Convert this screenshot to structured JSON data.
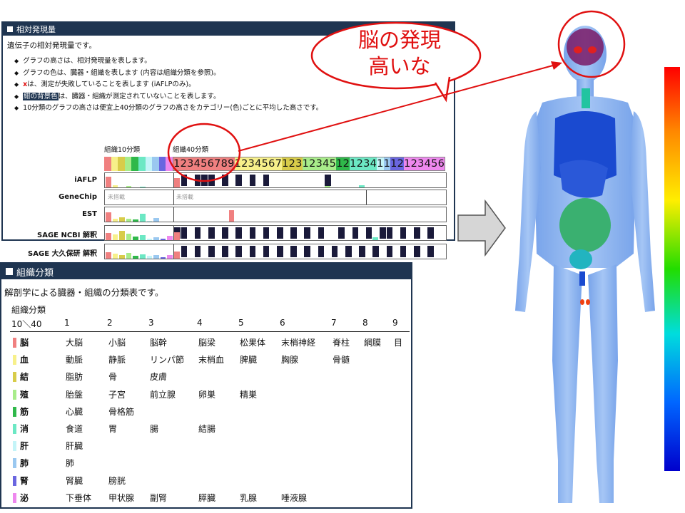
{
  "panel1": {
    "title": "相対発現量",
    "description": "遺伝子の相対発現量です。",
    "notes": [
      {
        "pre": "",
        "em": "",
        "post": "グラフの高さは、相対発現量を表します。"
      },
      {
        "pre": "",
        "em": "",
        "post": "グラフの色は、臓器・組織を表します (内容は組織分類を参照)。"
      },
      {
        "pre": "",
        "em": "x",
        "post": "は、測定が失敗していることを表します (iAFLPのみ)。"
      },
      {
        "pre": "",
        "em": "紺の背景色",
        "post": "は、臓器・組織が測定されていないことを表します。"
      },
      {
        "pre": "",
        "em": "",
        "post": "10分類のグラフの高さは便宜上40分類のグラフの高さをカテゴリー(色)ごとに平均した高さです。"
      }
    ],
    "label_10": "組織10分類",
    "label_40": "組織40分類",
    "digits": [
      "1",
      "2",
      "3",
      "4",
      "5",
      "6",
      "7",
      "8",
      "9",
      "1",
      "2",
      "3",
      "4",
      "5",
      "6",
      "7",
      "1",
      "2",
      "3",
      "1",
      "2",
      "3",
      "4",
      "5",
      "1",
      "2",
      "1",
      "2",
      "3",
      "4",
      "1",
      "1",
      "1",
      "2",
      "1",
      "2",
      "3",
      "4",
      "5",
      "6"
    ],
    "digit_colors": [
      "#f08080",
      "#f08080",
      "#f08080",
      "#f08080",
      "#f08080",
      "#f08080",
      "#f08080",
      "#f08080",
      "#f08080",
      "#f7f08a",
      "#f7f08a",
      "#f7f08a",
      "#f7f08a",
      "#f7f08a",
      "#f7f08a",
      "#f7f08a",
      "#d8cc4a",
      "#d8cc4a",
      "#d8cc4a",
      "#a8ec8a",
      "#a8ec8a",
      "#a8ec8a",
      "#a8ec8a",
      "#a8ec8a",
      "#2fb84a",
      "#2fb84a",
      "#6ce8c4",
      "#6ce8c4",
      "#6ce8c4",
      "#6ce8c4",
      "#c4f4f8",
      "#9ac8f0",
      "#6a66e0",
      "#6a66e0",
      "#ee88ee",
      "#ee88ee",
      "#ee88ee",
      "#ee88ee",
      "#ee88ee",
      "#ee88ee"
    ],
    "cats10_colors": [
      "#f08080",
      "#f7f08a",
      "#d8cc4a",
      "#a8ec8a",
      "#2fb84a",
      "#6ce8c4",
      "#c4f4f8",
      "#9ac8f0",
      "#6a66e0",
      "#ee88ee"
    ],
    "na_text": "未搭載",
    "rows": [
      {
        "label": "iAFLP",
        "bars10": [
          0.85,
          0.15,
          0,
          0.1,
          0,
          0.05,
          0,
          0,
          0,
          0
        ],
        "bars40": [
          0.75,
          0,
          0,
          0,
          0,
          0,
          0,
          0,
          0,
          0,
          0,
          0,
          0,
          0,
          0,
          0,
          0,
          0,
          0,
          0,
          0,
          0,
          0.12,
          0,
          0,
          0,
          0,
          0.18,
          0,
          0,
          0,
          0,
          0,
          0,
          0,
          0,
          0,
          0,
          0,
          0
        ],
        "blocks": [
          1,
          3,
          4,
          5,
          7,
          9,
          11,
          13,
          22
        ],
        "na": false
      },
      {
        "label": "GeneChip",
        "bars10": [],
        "bars40": [],
        "blocks": [],
        "na": true
      },
      {
        "label": "EST",
        "bars10": [
          0.7,
          0.2,
          0.35,
          0.2,
          0.15,
          0.6,
          0.05,
          0.3,
          0,
          0
        ],
        "bars40": [
          0,
          0,
          0,
          0,
          0,
          0,
          0,
          0,
          0.9,
          0,
          0,
          0,
          0,
          0,
          0,
          0,
          0,
          0,
          0,
          0,
          0,
          0,
          0,
          0,
          0,
          0,
          0,
          0,
          0,
          0,
          0,
          0,
          0,
          0,
          0,
          0,
          0,
          0,
          0,
          0
        ],
        "blocks": [],
        "na": false
      },
      {
        "label": "SAGE NCBI 解釈",
        "bars10": [
          0.55,
          0.45,
          0.7,
          0.5,
          0.3,
          0.4,
          0.1,
          0.25,
          0.1,
          0.35
        ],
        "bars40": [
          0.6,
          0,
          0,
          0,
          0,
          0,
          0,
          0,
          0,
          0,
          0,
          0,
          0,
          0,
          0,
          0,
          0,
          0,
          0,
          0,
          0,
          0,
          0,
          0,
          0,
          0,
          0,
          0,
          0,
          0.2,
          0,
          0,
          0,
          0,
          0,
          0,
          0,
          0,
          0,
          0
        ],
        "blocks": [
          0,
          1,
          3,
          5,
          7,
          9,
          11,
          13,
          15,
          17,
          19,
          21,
          24,
          26,
          28,
          30,
          31,
          33,
          35,
          37
        ],
        "na": false
      },
      {
        "label": "SAGE 大久保研 解釈",
        "bars10": [
          0.5,
          0.4,
          0.3,
          0.45,
          0.25,
          0.35,
          0.2,
          0.3,
          0.1,
          0.3
        ],
        "bars40": [
          0.55,
          0,
          0,
          0,
          0,
          0,
          0,
          0,
          0,
          0,
          0,
          0,
          0,
          0,
          0,
          0,
          0,
          0,
          0,
          0,
          0,
          0,
          0,
          0,
          0,
          0,
          0,
          0,
          0,
          0,
          0,
          0,
          0,
          0,
          0,
          0,
          0,
          0,
          0,
          0
        ],
        "blocks": [
          1,
          3,
          5,
          7,
          9,
          11,
          13,
          15,
          17,
          19,
          21,
          23,
          25,
          27,
          29,
          31,
          33,
          35,
          37
        ],
        "na": false
      }
    ]
  },
  "panel2": {
    "title": "組織分類",
    "description": "解剖学による臓器・組織の分類表です。",
    "header_main": "組織分類",
    "header_sub": "10＼40",
    "col_nums": [
      "1",
      "2",
      "3",
      "4",
      "5",
      "6",
      "7",
      "8",
      "9"
    ],
    "rows": [
      {
        "cat": "脳",
        "color": "#f08080",
        "items": [
          "大脳",
          "小脳",
          "脳幹",
          "脳梁",
          "松果体",
          "末梢神経",
          "脊柱",
          "網膜",
          "目"
        ]
      },
      {
        "cat": "血",
        "color": "#f7f08a",
        "items": [
          "動脈",
          "静脈",
          "リンパ節",
          "末梢血",
          "脾臓",
          "胸腺",
          "骨髄",
          "",
          ""
        ]
      },
      {
        "cat": "結",
        "color": "#d8cc4a",
        "items": [
          "脂肪",
          "骨",
          "皮膚",
          "",
          "",
          "",
          "",
          "",
          ""
        ]
      },
      {
        "cat": "殖",
        "color": "#a8ec8a",
        "items": [
          "胎盤",
          "子宮",
          "前立腺",
          "卵巣",
          "精巣",
          "",
          "",
          "",
          ""
        ]
      },
      {
        "cat": "筋",
        "color": "#2fb84a",
        "items": [
          "心臓",
          "骨格筋",
          "",
          "",
          "",
          "",
          "",
          "",
          ""
        ]
      },
      {
        "cat": "消",
        "color": "#6ce8c4",
        "items": [
          "食道",
          "胃",
          "腸",
          "結腸",
          "",
          "",
          "",
          "",
          ""
        ]
      },
      {
        "cat": "肝",
        "color": "#c4f4f8",
        "items": [
          "肝臓",
          "",
          "",
          "",
          "",
          "",
          "",
          "",
          ""
        ]
      },
      {
        "cat": "肺",
        "color": "#9ac8f0",
        "items": [
          "肺",
          "",
          "",
          "",
          "",
          "",
          "",
          "",
          ""
        ]
      },
      {
        "cat": "腎",
        "color": "#6a66e0",
        "items": [
          "腎臓",
          "膀胱",
          "",
          "",
          "",
          "",
          "",
          "",
          ""
        ]
      },
      {
        "cat": "泌",
        "color": "#ee88ee",
        "items": [
          "下垂体",
          "甲状腺",
          "副腎",
          "膵臓",
          "乳腺",
          "唾液腺",
          "",
          "",
          ""
        ]
      }
    ]
  },
  "callout": {
    "line1": "脳の発現",
    "line2": "高いな"
  }
}
